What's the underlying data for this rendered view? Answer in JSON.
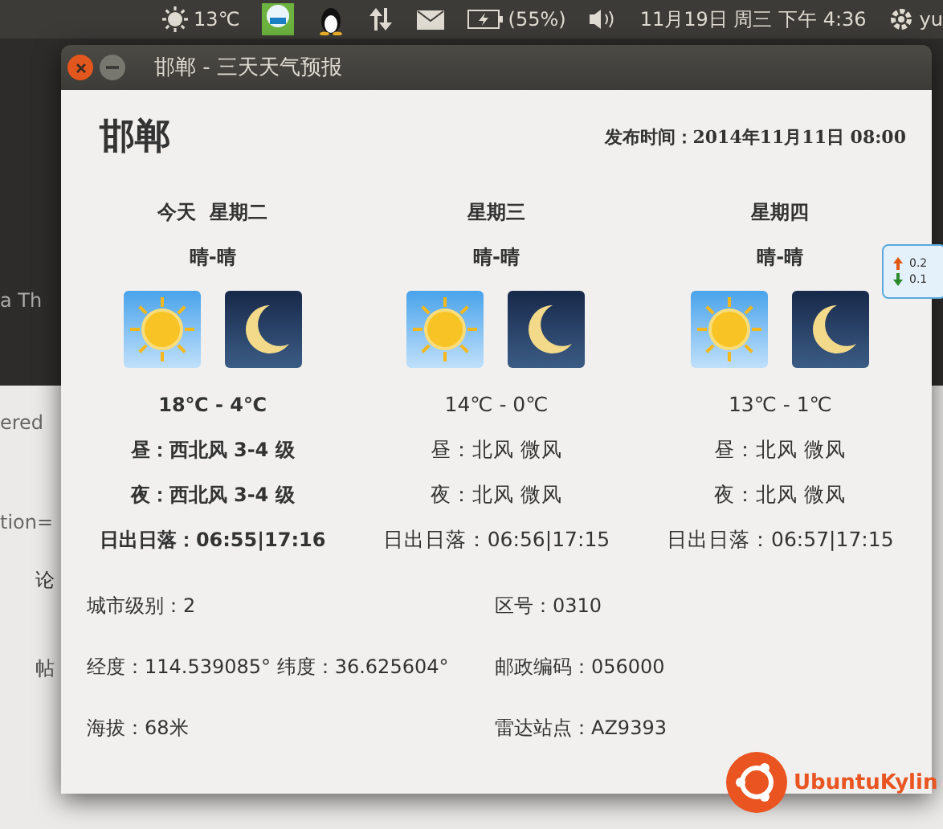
{
  "top_panel": {
    "weather_temp": "13℃",
    "battery": "(55%)",
    "datetime": "11月19日 周三 下午 4:36",
    "user": "yu"
  },
  "background": {
    "texts": [
      "a Th",
      "ered",
      "tion=",
      "论",
      "帖"
    ],
    "net_speed": [
      "0.2",
      "0.1"
    ],
    "logo": "UbuntuKylin"
  },
  "window": {
    "title": "邯郸 - 三天天气预报"
  },
  "city": "邯郸",
  "publish_time": "发布时间：2014年11月11日 08:00",
  "days": [
    {
      "day": "今天  星期二",
      "weather": "晴-晴",
      "temp": "18℃ - 4℃",
      "day_wind": "昼：西北风 3-4 级",
      "night_wind": "夜：西北风 3-4 级",
      "sun": "日出日落：",
      "sun_times": "06:55|17:16",
      "highlighted": true
    },
    {
      "day": "星期三",
      "weather": "晴-晴",
      "temp": "14℃ - 0℃",
      "day_wind": "昼：北风 微风",
      "night_wind": "夜：北风 微风",
      "sun": "日出日落：",
      "sun_times": "06:56|17:15",
      "highlighted": false
    },
    {
      "day": "星期四",
      "weather": "晴-晴",
      "temp": "13℃ - 1℃",
      "day_wind": "昼：北风 微风",
      "night_wind": "夜：北风 微风",
      "sun": "日出日落：",
      "sun_times": "06:57|17:15",
      "highlighted": false
    }
  ],
  "info": [
    "城市级别：2",
    "区号：0310",
    "经度：114.539085° 纬度：36.625604°",
    "邮政编码：056000",
    "海拔：68米",
    "雷达站点：AZ9393"
  ]
}
